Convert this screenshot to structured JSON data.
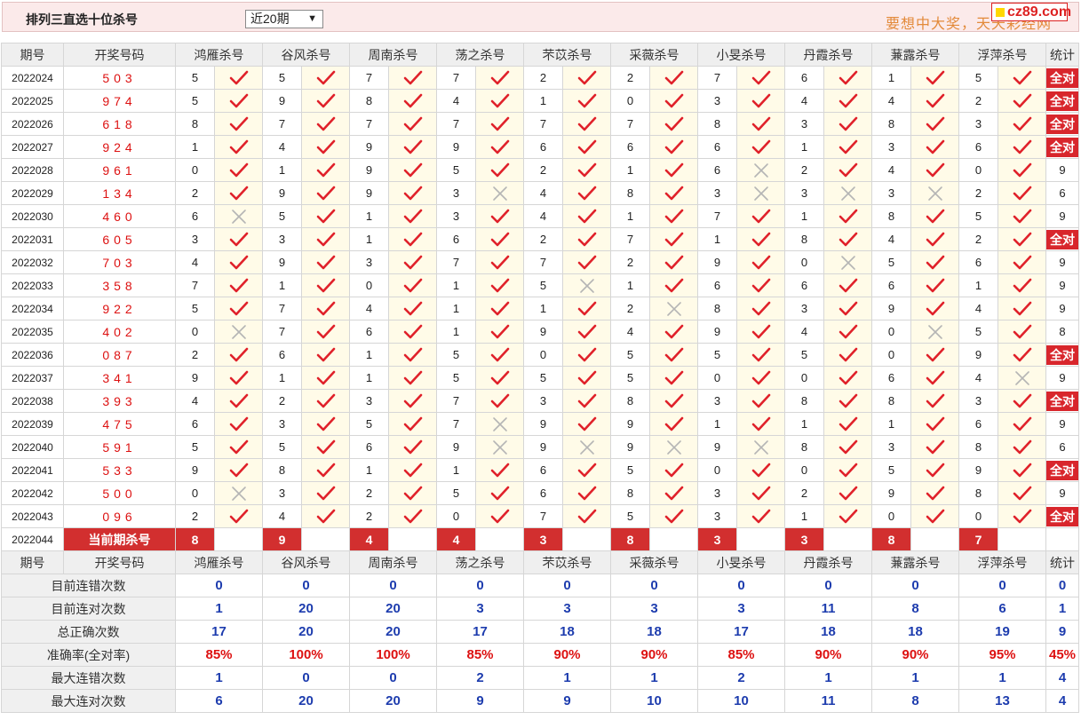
{
  "header": {
    "title": "排列三直选十位杀号",
    "select_value": "近20期",
    "slogan": "要想中大奖，天天彩经网",
    "logo_text": "cz89.com"
  },
  "colors": {
    "check": "#e0212a",
    "cross": "#b5b5b5",
    "badge": "#d8262c",
    "accent_blue": "#1d3cae"
  },
  "icons": {
    "hit": "check-icon",
    "miss": "cross-icon"
  },
  "columns": {
    "period": "期号",
    "draw": "开奖号码",
    "experts": [
      "鸿雁杀号",
      "谷风杀号",
      "周南杀号",
      "荡之杀号",
      "芣苡杀号",
      "采薇杀号",
      "小旻杀号",
      "丹霞杀号",
      "蒹露杀号",
      "浮萍杀号"
    ],
    "stat": "统计"
  },
  "all_correct_label": "全对",
  "rows": [
    {
      "period": "2022024",
      "draw": "503",
      "kills": [
        [
          "5",
          1
        ],
        [
          "5",
          1
        ],
        [
          "7",
          1
        ],
        [
          "7",
          1
        ],
        [
          "2",
          1
        ],
        [
          "2",
          1
        ],
        [
          "7",
          1
        ],
        [
          "6",
          1
        ],
        [
          "1",
          1
        ],
        [
          "5",
          1
        ]
      ],
      "stat": "全对"
    },
    {
      "period": "2022025",
      "draw": "974",
      "kills": [
        [
          "5",
          1
        ],
        [
          "9",
          1
        ],
        [
          "8",
          1
        ],
        [
          "4",
          1
        ],
        [
          "1",
          1
        ],
        [
          "0",
          1
        ],
        [
          "3",
          1
        ],
        [
          "4",
          1
        ],
        [
          "4",
          1
        ],
        [
          "2",
          1
        ]
      ],
      "stat": "全对"
    },
    {
      "period": "2022026",
      "draw": "618",
      "kills": [
        [
          "8",
          1
        ],
        [
          "7",
          1
        ],
        [
          "7",
          1
        ],
        [
          "7",
          1
        ],
        [
          "7",
          1
        ],
        [
          "7",
          1
        ],
        [
          "8",
          1
        ],
        [
          "3",
          1
        ],
        [
          "8",
          1
        ],
        [
          "3",
          1
        ]
      ],
      "stat": "全对"
    },
    {
      "period": "2022027",
      "draw": "924",
      "kills": [
        [
          "1",
          1
        ],
        [
          "4",
          1
        ],
        [
          "9",
          1
        ],
        [
          "9",
          1
        ],
        [
          "6",
          1
        ],
        [
          "6",
          1
        ],
        [
          "6",
          1
        ],
        [
          "1",
          1
        ],
        [
          "3",
          1
        ],
        [
          "6",
          1
        ]
      ],
      "stat": "全对"
    },
    {
      "period": "2022028",
      "draw": "961",
      "kills": [
        [
          "0",
          1
        ],
        [
          "1",
          1
        ],
        [
          "9",
          1
        ],
        [
          "5",
          1
        ],
        [
          "2",
          1
        ],
        [
          "1",
          1
        ],
        [
          "6",
          0
        ],
        [
          "2",
          1
        ],
        [
          "4",
          1
        ],
        [
          "0",
          1
        ]
      ],
      "stat": "9"
    },
    {
      "period": "2022029",
      "draw": "134",
      "kills": [
        [
          "2",
          1
        ],
        [
          "9",
          1
        ],
        [
          "9",
          1
        ],
        [
          "3",
          0
        ],
        [
          "4",
          1
        ],
        [
          "8",
          1
        ],
        [
          "3",
          0
        ],
        [
          "3",
          0
        ],
        [
          "3",
          0
        ],
        [
          "2",
          1
        ]
      ],
      "stat": "6"
    },
    {
      "period": "2022030",
      "draw": "460",
      "kills": [
        [
          "6",
          0
        ],
        [
          "5",
          1
        ],
        [
          "1",
          1
        ],
        [
          "3",
          1
        ],
        [
          "4",
          1
        ],
        [
          "1",
          1
        ],
        [
          "7",
          1
        ],
        [
          "1",
          1
        ],
        [
          "8",
          1
        ],
        [
          "5",
          1
        ]
      ],
      "stat": "9"
    },
    {
      "period": "2022031",
      "draw": "605",
      "kills": [
        [
          "3",
          1
        ],
        [
          "3",
          1
        ],
        [
          "1",
          1
        ],
        [
          "6",
          1
        ],
        [
          "2",
          1
        ],
        [
          "7",
          1
        ],
        [
          "1",
          1
        ],
        [
          "8",
          1
        ],
        [
          "4",
          1
        ],
        [
          "2",
          1
        ]
      ],
      "stat": "全对"
    },
    {
      "period": "2022032",
      "draw": "703",
      "kills": [
        [
          "4",
          1
        ],
        [
          "9",
          1
        ],
        [
          "3",
          1
        ],
        [
          "7",
          1
        ],
        [
          "7",
          1
        ],
        [
          "2",
          1
        ],
        [
          "9",
          1
        ],
        [
          "0",
          0
        ],
        [
          "5",
          1
        ],
        [
          "6",
          1
        ]
      ],
      "stat": "9"
    },
    {
      "period": "2022033",
      "draw": "358",
      "kills": [
        [
          "7",
          1
        ],
        [
          "1",
          1
        ],
        [
          "0",
          1
        ],
        [
          "1",
          1
        ],
        [
          "5",
          0
        ],
        [
          "1",
          1
        ],
        [
          "6",
          1
        ],
        [
          "6",
          1
        ],
        [
          "6",
          1
        ],
        [
          "1",
          1
        ]
      ],
      "stat": "9"
    },
    {
      "period": "2022034",
      "draw": "922",
      "kills": [
        [
          "5",
          1
        ],
        [
          "7",
          1
        ],
        [
          "4",
          1
        ],
        [
          "1",
          1
        ],
        [
          "1",
          1
        ],
        [
          "2",
          0
        ],
        [
          "8",
          1
        ],
        [
          "3",
          1
        ],
        [
          "9",
          1
        ],
        [
          "4",
          1
        ]
      ],
      "stat": "9"
    },
    {
      "period": "2022035",
      "draw": "402",
      "kills": [
        [
          "0",
          0
        ],
        [
          "7",
          1
        ],
        [
          "6",
          1
        ],
        [
          "1",
          1
        ],
        [
          "9",
          1
        ],
        [
          "4",
          1
        ],
        [
          "9",
          1
        ],
        [
          "4",
          1
        ],
        [
          "0",
          0
        ],
        [
          "5",
          1
        ]
      ],
      "stat": "8"
    },
    {
      "period": "2022036",
      "draw": "087",
      "kills": [
        [
          "2",
          1
        ],
        [
          "6",
          1
        ],
        [
          "1",
          1
        ],
        [
          "5",
          1
        ],
        [
          "0",
          1
        ],
        [
          "5",
          1
        ],
        [
          "5",
          1
        ],
        [
          "5",
          1
        ],
        [
          "0",
          1
        ],
        [
          "9",
          1
        ]
      ],
      "stat": "全对"
    },
    {
      "period": "2022037",
      "draw": "341",
      "kills": [
        [
          "9",
          1
        ],
        [
          "1",
          1
        ],
        [
          "1",
          1
        ],
        [
          "5",
          1
        ],
        [
          "5",
          1
        ],
        [
          "5",
          1
        ],
        [
          "0",
          1
        ],
        [
          "0",
          1
        ],
        [
          "6",
          1
        ],
        [
          "4",
          0
        ]
      ],
      "stat": "9"
    },
    {
      "period": "2022038",
      "draw": "393",
      "kills": [
        [
          "4",
          1
        ],
        [
          "2",
          1
        ],
        [
          "3",
          1
        ],
        [
          "7",
          1
        ],
        [
          "3",
          1
        ],
        [
          "8",
          1
        ],
        [
          "3",
          1
        ],
        [
          "8",
          1
        ],
        [
          "8",
          1
        ],
        [
          "3",
          1
        ]
      ],
      "stat": "全对"
    },
    {
      "period": "2022039",
      "draw": "475",
      "kills": [
        [
          "6",
          1
        ],
        [
          "3",
          1
        ],
        [
          "5",
          1
        ],
        [
          "7",
          0
        ],
        [
          "9",
          1
        ],
        [
          "9",
          1
        ],
        [
          "1",
          1
        ],
        [
          "1",
          1
        ],
        [
          "1",
          1
        ],
        [
          "6",
          1
        ]
      ],
      "stat": "9"
    },
    {
      "period": "2022040",
      "draw": "591",
      "kills": [
        [
          "5",
          1
        ],
        [
          "5",
          1
        ],
        [
          "6",
          1
        ],
        [
          "9",
          0
        ],
        [
          "9",
          0
        ],
        [
          "9",
          0
        ],
        [
          "9",
          0
        ],
        [
          "8",
          1
        ],
        [
          "3",
          1
        ],
        [
          "8",
          1
        ]
      ],
      "stat": "6"
    },
    {
      "period": "2022041",
      "draw": "533",
      "kills": [
        [
          "9",
          1
        ],
        [
          "8",
          1
        ],
        [
          "1",
          1
        ],
        [
          "1",
          1
        ],
        [
          "6",
          1
        ],
        [
          "5",
          1
        ],
        [
          "0",
          1
        ],
        [
          "0",
          1
        ],
        [
          "5",
          1
        ],
        [
          "9",
          1
        ]
      ],
      "stat": "全对"
    },
    {
      "period": "2022042",
      "draw": "500",
      "kills": [
        [
          "0",
          0
        ],
        [
          "3",
          1
        ],
        [
          "2",
          1
        ],
        [
          "5",
          1
        ],
        [
          "6",
          1
        ],
        [
          "8",
          1
        ],
        [
          "3",
          1
        ],
        [
          "2",
          1
        ],
        [
          "9",
          1
        ],
        [
          "8",
          1
        ]
      ],
      "stat": "9"
    },
    {
      "period": "2022043",
      "draw": "096",
      "kills": [
        [
          "2",
          1
        ],
        [
          "4",
          1
        ],
        [
          "2",
          1
        ],
        [
          "0",
          1
        ],
        [
          "7",
          1
        ],
        [
          "5",
          1
        ],
        [
          "3",
          1
        ],
        [
          "1",
          1
        ],
        [
          "0",
          1
        ],
        [
          "0",
          1
        ]
      ],
      "stat": "全对"
    }
  ],
  "current": {
    "period": "2022044",
    "label": "当前期杀号",
    "kills": [
      "8",
      "9",
      "4",
      "4",
      "3",
      "8",
      "3",
      "3",
      "8",
      "7"
    ]
  },
  "summary": [
    {
      "label": "目前连错次数",
      "values": [
        "0",
        "0",
        "0",
        "0",
        "0",
        "0",
        "0",
        "0",
        "0",
        "0"
      ],
      "stat": "0",
      "red": false
    },
    {
      "label": "目前连对次数",
      "values": [
        "1",
        "20",
        "20",
        "3",
        "3",
        "3",
        "3",
        "11",
        "8",
        "6"
      ],
      "stat": "1",
      "red": false
    },
    {
      "label": "总正确次数",
      "values": [
        "17",
        "20",
        "20",
        "17",
        "18",
        "18",
        "17",
        "18",
        "18",
        "19"
      ],
      "stat": "9",
      "red": false
    },
    {
      "label": "准确率(全对率)",
      "values": [
        "85%",
        "100%",
        "100%",
        "85%",
        "90%",
        "90%",
        "85%",
        "90%",
        "90%",
        "95%"
      ],
      "stat": "45%",
      "red": true
    },
    {
      "label": "最大连错次数",
      "values": [
        "1",
        "0",
        "0",
        "2",
        "1",
        "1",
        "2",
        "1",
        "1",
        "1"
      ],
      "stat": "4",
      "red": false
    },
    {
      "label": "最大连对次数",
      "values": [
        "6",
        "20",
        "20",
        "9",
        "9",
        "10",
        "10",
        "11",
        "8",
        "13"
      ],
      "stat": "4",
      "red": false
    }
  ]
}
